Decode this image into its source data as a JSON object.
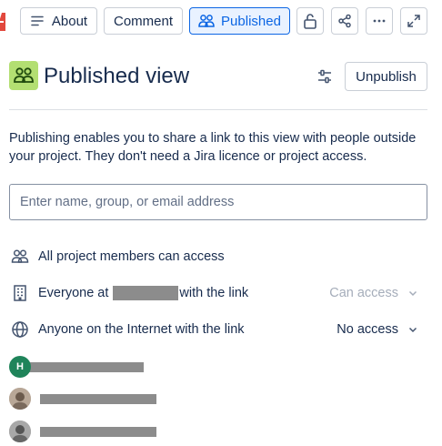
{
  "toolbar": {
    "about_label": "About",
    "comment_label": "Comment",
    "published_label": "Published"
  },
  "header": {
    "title": "Published view",
    "unpublish_label": "Unpublish"
  },
  "description": "Publishing enables you to share a link to this view with people outside your project. They don't need a Jira licence or project access.",
  "search": {
    "placeholder": "Enter name, group, or email address"
  },
  "access_rows": [
    {
      "label": "All project members can access"
    },
    {
      "label_prefix": "Everyone at",
      "label_suffix": "with the link",
      "access": "Can access",
      "access_disabled": true
    },
    {
      "label": "Anyone on the Internet with the link",
      "access": "No access"
    }
  ],
  "users": [
    {
      "avatar_initial": "H",
      "avatar_color": "#1f845a"
    },
    {
      "avatar_initial": "",
      "avatar_color": "#9a8a7c"
    },
    {
      "avatar_initial": "",
      "avatar_color": "#8d8d8d"
    }
  ],
  "colors": {
    "accent": "#0c66e4",
    "published_bg": "#e9f2ff",
    "header_icon_bg": "#b3df72"
  }
}
